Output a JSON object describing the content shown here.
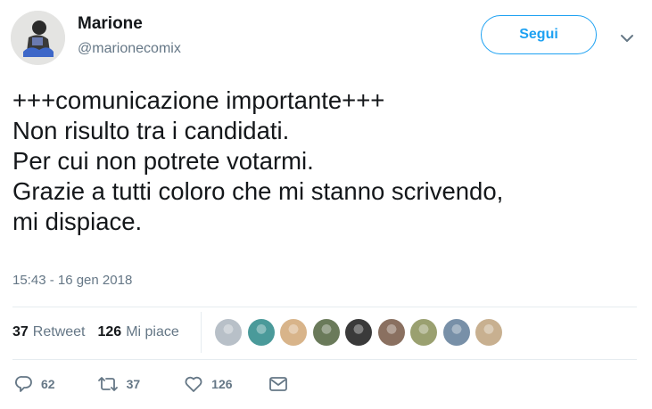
{
  "author": {
    "name": "Marione",
    "handle": "@marionecomix"
  },
  "follow_label": "Segui",
  "tweet": {
    "lines": [
      "+++comunicazione importante+++",
      "Non risulto tra i candidati.",
      "Per cui non potrete votarmi.",
      "Grazie a tutti coloro che mi stanno scrivendo,",
      "mi dispiace."
    ],
    "timestamp": "15:43 - 16 gen 2018"
  },
  "stats": {
    "retweet_count": "37",
    "retweet_label": "Retweet",
    "like_count": "126",
    "like_label": "Mi piace"
  },
  "likers": [
    {
      "color": "#b8c0c8"
    },
    {
      "color": "#4a9a9a"
    },
    {
      "color": "#d8b48a"
    },
    {
      "color": "#6a7a5a"
    },
    {
      "color": "#3a3a3a"
    },
    {
      "color": "#8a7060"
    },
    {
      "color": "#9aa070"
    },
    {
      "color": "#7890a8"
    },
    {
      "color": "#c8b090"
    }
  ],
  "actions": {
    "reply_count": "62",
    "retweet_count": "37",
    "like_count": "126"
  },
  "colors": {
    "accent": "#1da1f2",
    "secondary_text": "#657786",
    "primary_text": "#14171a"
  }
}
